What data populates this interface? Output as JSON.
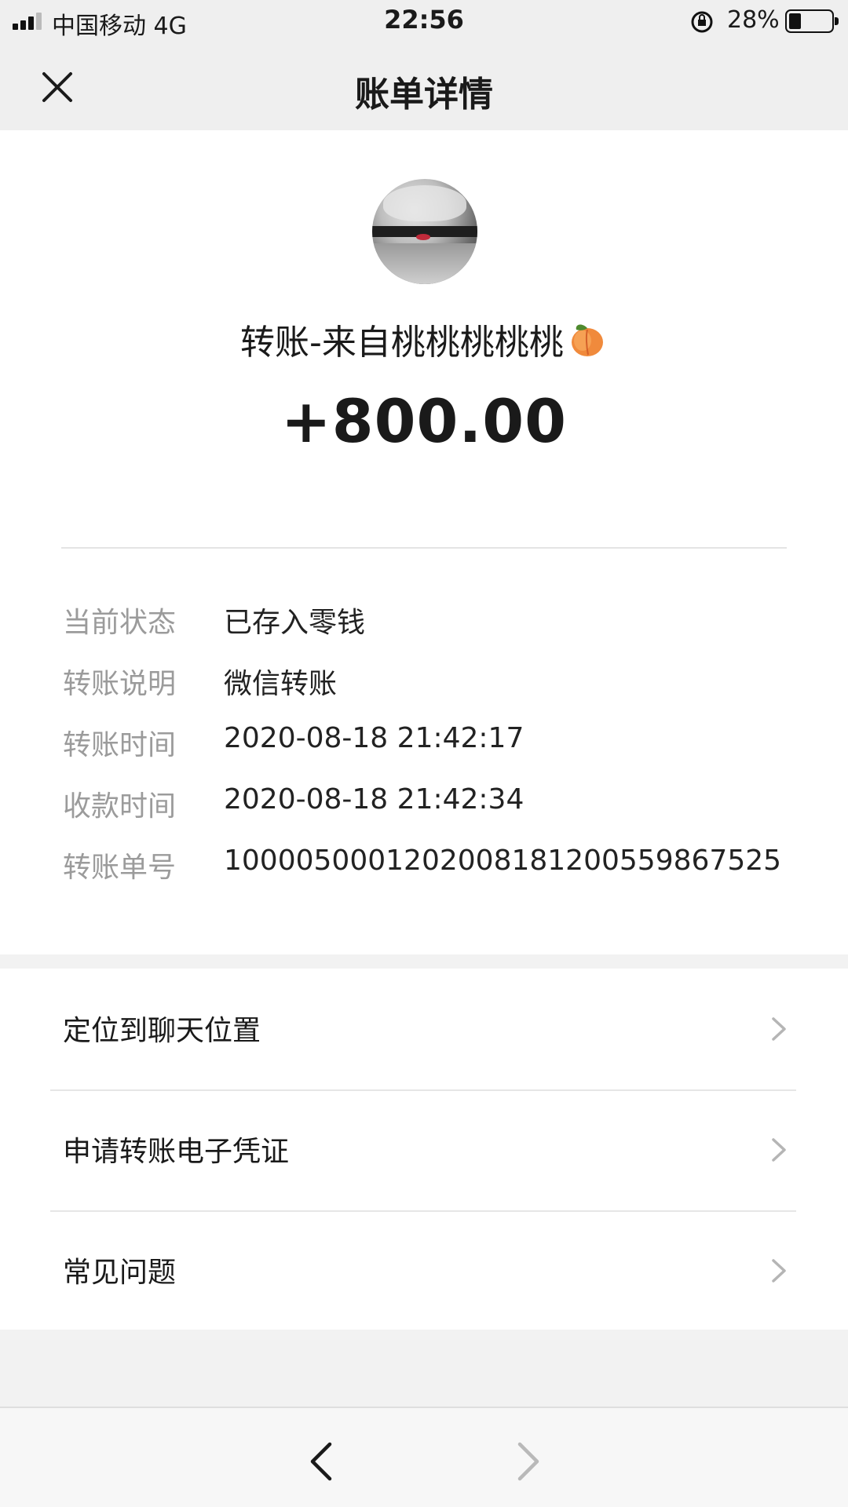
{
  "status_bar": {
    "carrier": "中国移动   4G",
    "time": "22:56",
    "battery": "28%",
    "battery_level": 0.28
  },
  "nav": {
    "title": "账单详情",
    "close_icon": "close-icon"
  },
  "transfer": {
    "title": "转账-来自桃桃桃桃桃",
    "emoji": "peach-icon",
    "amount": "+800.00"
  },
  "details": [
    {
      "label": "当前状态",
      "value": "已存入零钱"
    },
    {
      "label": "转账说明",
      "value": "微信转账"
    },
    {
      "label": "转账时间",
      "value": "2020-08-18 21:42:17"
    },
    {
      "label": "收款时间",
      "value": "2020-08-18 21:42:34"
    },
    {
      "label": "转账单号",
      "value": "1000050001202008181200559867525"
    }
  ],
  "actions": [
    {
      "label": "定位到聊天位置"
    },
    {
      "label": "申请转账电子凭证"
    },
    {
      "label": "常见问题"
    }
  ],
  "bottom_bar": {
    "back_icon": "chevron-left-icon",
    "forward_icon": "chevron-right-icon"
  },
  "colors": {
    "background": "#f2f2f2",
    "card": "#ffffff",
    "label_gray": "#9b9b9b",
    "text": "#1a1a1a"
  }
}
